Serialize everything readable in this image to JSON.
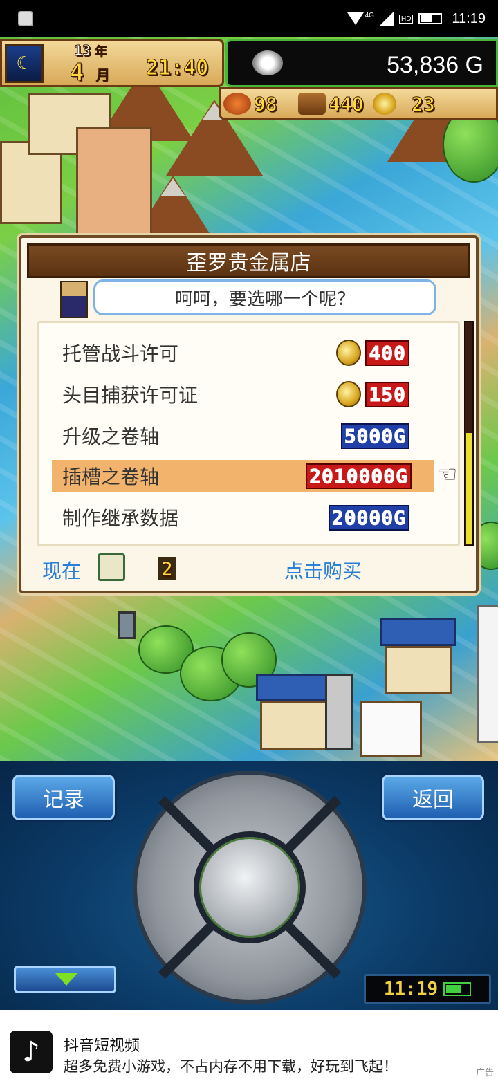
{
  "status_bar": {
    "net": "4G",
    "hd": "HD",
    "time": "11:19"
  },
  "hud": {
    "year_num": "13",
    "year_label": "年",
    "month_num": "4",
    "month_label": "月",
    "clock": "21:40",
    "gold": "53,836 G",
    "resources": {
      "food": "98",
      "wood": "440",
      "medals": "23"
    }
  },
  "dialog": {
    "title": "歪罗贵金属店",
    "speech": "呵呵，要选哪一个呢？",
    "items": [
      {
        "label": "托管战斗许可",
        "price": "400",
        "currency": "medal"
      },
      {
        "label": "头目捕获许可证",
        "price": "150",
        "currency": "medal"
      },
      {
        "label": "升级之卷轴",
        "price": "5000G",
        "currency": "gold"
      },
      {
        "label": "插槽之卷轴",
        "price": "2010000G",
        "currency": "gold",
        "selected": true,
        "affordable": false
      },
      {
        "label": "制作继承数据",
        "price": "20000G",
        "currency": "gold"
      }
    ],
    "footer": {
      "now_label": "现在",
      "owned_count": "2",
      "buy_hint": "点击购买"
    }
  },
  "controller": {
    "record_label": "记录",
    "back_label": "返回",
    "device_time": "11:19"
  },
  "ad": {
    "app_name": "抖音短视频",
    "description": "超多免费小游戏，不占内存不用下载，好玩到飞起！",
    "tag": "广告"
  },
  "colors": {
    "selected_row": "#f2b36c",
    "price_red": "#c81818",
    "price_blue": "#2040a8",
    "hint_blue": "#2a7fd8",
    "money_border": "#4bb53a"
  },
  "icons": [
    "app-icon",
    "wifi-icon",
    "signal-icon",
    "battery-icon",
    "moon-icon",
    "gold-coin-icon",
    "food-icon",
    "wood-icon",
    "medal-icon",
    "pointing-hand-icon",
    "scroll-icon",
    "triangle-down-icon",
    "tiktok-icon"
  ]
}
